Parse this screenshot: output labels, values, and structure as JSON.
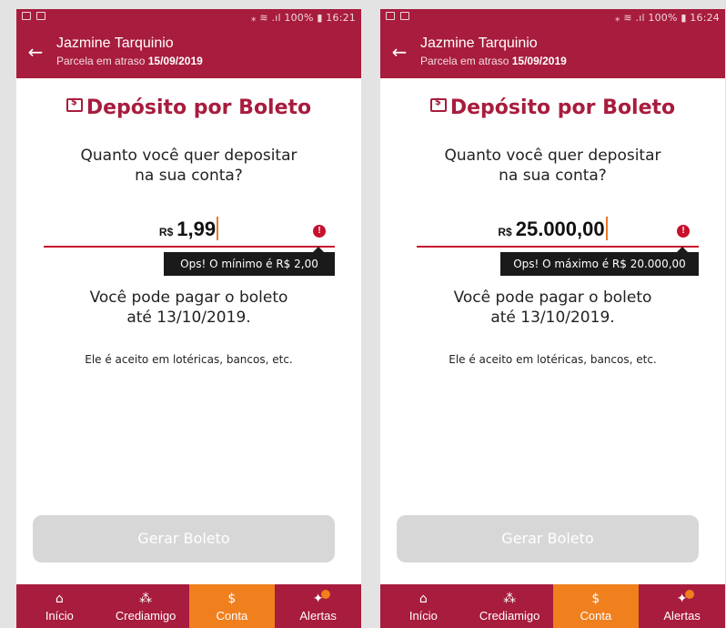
{
  "colors": {
    "primary": "#a81c3d",
    "accent": "#f07f1e",
    "error": "#c8102e",
    "disabled": "#d7d7d7"
  },
  "screens": [
    {
      "status": {
        "right": "⁎ ≋ .ıl 100% ▮ 16:21"
      },
      "header": {
        "name": "Jazmine Tarquinio",
        "subtitle_prefix": "Parcela em atraso",
        "subtitle_date": "15/09/2019"
      },
      "title": "Depósito por Boleto",
      "question_line1": "Quanto você quer depositar",
      "question_line2": "na sua conta?",
      "currency": "R$",
      "amount": "1,99",
      "error_icon": "!",
      "tooltip": "Ops! O mínimo é R$ 2,00",
      "pay_line1": "Você pode pagar o boleto",
      "pay_line2": "até 13/10/2019.",
      "accepted": "Ele é aceito em lotéricas, bancos, etc.",
      "button": "Gerar Boleto",
      "nav": [
        {
          "icon": "home-icon",
          "glyph": "⌂",
          "label": "Início"
        },
        {
          "icon": "people-icon",
          "glyph": "⁂",
          "label": "Crediamigo"
        },
        {
          "icon": "dollar-icon",
          "glyph": "$",
          "label": "Conta",
          "active": true
        },
        {
          "icon": "bell-icon",
          "glyph": "✦",
          "label": "Alertas"
        }
      ]
    },
    {
      "status": {
        "right": "⁎ ≋ .ıl 100% ▮ 16:24"
      },
      "header": {
        "name": "Jazmine Tarquinio",
        "subtitle_prefix": "Parcela em atraso",
        "subtitle_date": "15/09/2019"
      },
      "title": "Depósito por Boleto",
      "question_line1": "Quanto você quer depositar",
      "question_line2": "na sua conta?",
      "currency": "R$",
      "amount": "25.000,00",
      "error_icon": "!",
      "tooltip": "Ops! O máximo é R$ 20.000,00",
      "pay_line1": "Você pode pagar o boleto",
      "pay_line2": "até 13/10/2019.",
      "accepted": "Ele é aceito em lotéricas, bancos, etc.",
      "button": "Gerar Boleto",
      "nav": [
        {
          "icon": "home-icon",
          "glyph": "⌂",
          "label": "Início"
        },
        {
          "icon": "people-icon",
          "glyph": "⁂",
          "label": "Crediamigo"
        },
        {
          "icon": "dollar-icon",
          "glyph": "$",
          "label": "Conta",
          "active": true
        },
        {
          "icon": "bell-icon",
          "glyph": "✦",
          "label": "Alertas"
        }
      ]
    }
  ]
}
